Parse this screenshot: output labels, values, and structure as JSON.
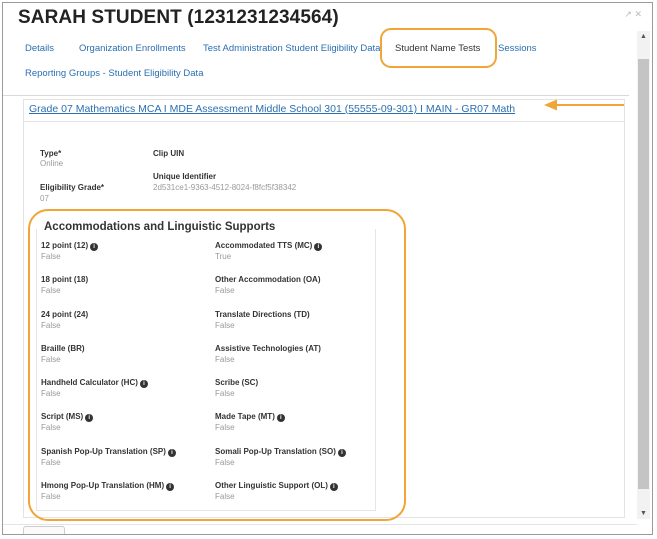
{
  "window": {
    "title": "SARAH STUDENT (1231231234564)",
    "controls": "↗ ✕"
  },
  "tabs": [
    {
      "label": "Details"
    },
    {
      "label": "Organization Enrollments"
    },
    {
      "label": "Test Administration Student Eligibility Data"
    },
    {
      "label": "Student Name Tests",
      "active": true
    },
    {
      "label": "Sessions"
    },
    {
      "label": "Reporting Groups - Student Eligibility Data"
    }
  ],
  "assessment": {
    "link": "Grade 07 Mathematics MCA I MDE Assessment Middle School 301 (55555-09-301) I MAIN - GR07 Math"
  },
  "details": {
    "type": {
      "label": "Type*",
      "value": "Online"
    },
    "eligibility_grade": {
      "label": "Eligibility Grade*",
      "value": "07"
    },
    "clip_uin": {
      "label": "Clip UIN",
      "value": ""
    },
    "unique_identifier": {
      "label": "Unique Identifier",
      "value": "2d531ce1-9363-4512-8024-f8fcf5f38342"
    }
  },
  "accommodations": {
    "title": "Accommodations and Linguistic Supports",
    "items": [
      {
        "label": "12 point (12)",
        "value": "False",
        "info": true
      },
      {
        "label": "Accommodated TTS (MC)",
        "value": "True",
        "info": true
      },
      {
        "label": "18 point (18)",
        "value": "False",
        "info": false
      },
      {
        "label": "Other Accommodation (OA)",
        "value": "False",
        "info": false
      },
      {
        "label": "24 point (24)",
        "value": "False",
        "info": false
      },
      {
        "label": "Translate Directions (TD)",
        "value": "False",
        "info": false
      },
      {
        "label": "Braille (BR)",
        "value": "False",
        "info": false
      },
      {
        "label": "Assistive Technologies (AT)",
        "value": "False",
        "info": false
      },
      {
        "label": "Handheld Calculator (HC)",
        "value": "False",
        "info": true
      },
      {
        "label": "Scribe (SC)",
        "value": "False",
        "info": false
      },
      {
        "label": "Script (MS)",
        "value": "False",
        "info": true
      },
      {
        "label": "Made Tape (MT)",
        "value": "False",
        "info": true
      },
      {
        "label": "Spanish Pop-Up Translation (SP)",
        "value": "False",
        "info": true
      },
      {
        "label": "Somali Pop-Up Translation (SO)",
        "value": "False",
        "info": true
      },
      {
        "label": "Hmong Pop-Up Translation (HM)",
        "value": "False",
        "info": true
      },
      {
        "label": "Other Linguistic Support (OL)",
        "value": "False",
        "info": true
      }
    ]
  },
  "colors": {
    "link": "#2a6fb0",
    "highlight": "#f0a536"
  },
  "icons": {
    "info": "i",
    "arrow": "arrow-left-icon",
    "scroll_up": "▲",
    "scroll_down": "▼"
  }
}
